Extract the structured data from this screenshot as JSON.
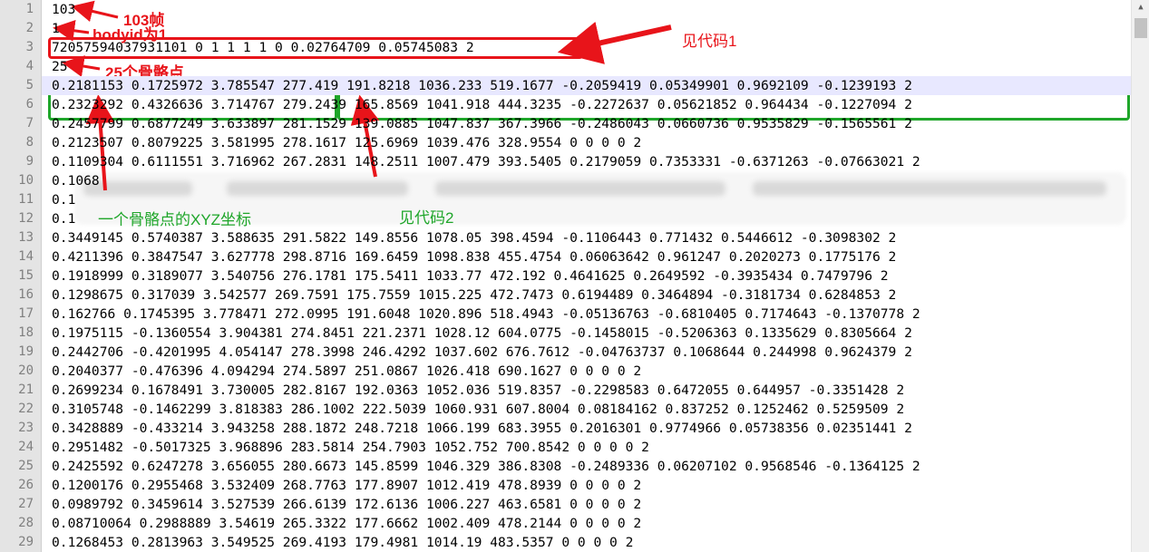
{
  "editor": {
    "line_numbers": [
      "1",
      "2",
      "3",
      "4",
      "5",
      "6",
      "7",
      "8",
      "9",
      "10",
      "11",
      "12",
      "13",
      "14",
      "15",
      "16",
      "17",
      "18",
      "19",
      "20",
      "21",
      "22",
      "23",
      "24",
      "25",
      "26",
      "27",
      "28",
      "29"
    ],
    "lines": [
      "103",
      "1",
      "72057594037931101 0 1 1 1 1 0 0.02764709 0.05745083 2",
      "25",
      "0.2181153 0.1725972 3.785547 277.419 191.8218 1036.233 519.1677 -0.2059419 0.05349901 0.9692109 -0.1239193 2",
      "0.2323292 0.4326636 3.714767 279.2439 165.8569 1041.918 444.3235 -0.2272637 0.05621852 0.964434 -0.1227094 2",
      "0.2457799 0.6877249 3.633897 281.1529 139.0885 1047.837 367.3966 -0.2486043 0.0660736 0.9535829 -0.1565561 2",
      "0.2123507 0.8079225 3.581995 278.1617 125.6969 1039.476 328.9554 0 0 0 0 2",
      "0.1109304 0.6111551 3.716962 267.2831 148.2511 1007.479 393.5405 0.2179059 0.7353331 -0.6371263 -0.07663021 2",
      "0.1068",
      "0.1",
      "0.1",
      "0.3449145 0.5740387 3.588635 291.5822 149.8556 1078.05 398.4594 -0.1106443 0.771432 0.5446612 -0.3098302 2",
      "0.4211396 0.3847547 3.627778 298.8716 169.6459 1098.838 455.4754 0.06063642 0.961247 0.2020273 0.1775176 2",
      "0.1918999 0.3189077 3.540756 276.1781 175.5411 1033.77 472.192 0.4641625 0.2649592 -0.3935434 0.7479796 2",
      "0.1298675 0.317039 3.542577 269.7591 175.7559 1015.225 472.7473 0.6194489 0.3464894 -0.3181734 0.6284853 2",
      "0.162766 0.1745395 3.778471 272.0995 191.6048 1020.896 518.4943 -0.05136763 -0.6810405 0.7174643 -0.1370778 2",
      "0.1975115 -0.1360554 3.904381 274.8451 221.2371 1028.12 604.0775 -0.1458015 -0.5206363 0.1335629 0.8305664 2",
      "0.2442706 -0.4201995 4.054147 278.3998 246.4292 1037.602 676.7612 -0.04763737 0.1068644 0.244998 0.9624379 2",
      "0.2040377 -0.476396 4.094294 274.5897 251.0867 1026.418 690.1627 0 0 0 0 2",
      "0.2699234 0.1678491 3.730005 282.8167 192.0363 1052.036 519.8357 -0.2298583 0.6472055 0.644957 -0.3351428 2",
      "0.3105748 -0.1462299 3.818383 286.1002 222.5039 1060.931 607.8004 0.08184162 0.837252 0.1252462 0.5259509 2",
      "0.3428889 -0.433214 3.943258 288.1872 248.7218 1066.199 683.3955 0.2016301 0.9774966 0.05738356 0.02351441 2",
      "0.2951482 -0.5017325 3.968896 283.5814 254.7903 1052.752 700.8542 0 0 0 0 2",
      "0.2425592 0.6247278 3.656055 280.6673 145.8599 1046.329 386.8308 -0.2489336 0.06207102 0.9568546 -0.1364125 2",
      "0.1200176 0.2955468 3.532409 268.7763 177.8907 1012.419 478.8939 0 0 0 0 2",
      "0.0989792 0.3459614 3.527539 266.6139 172.6136 1006.227 463.6581 0 0 0 0 2",
      "0.08710064 0.2988889 3.54619 265.3322 177.6662 1002.409 478.2144 0 0 0 0 2",
      "0.1268453 0.2813963 3.549525 269.4193 179.4981 1014.19 483.5357 0 0 0 0 2"
    ]
  },
  "annotations": {
    "frames": "103帧",
    "bodyid": "bodyid为1",
    "code1": "见代码1",
    "joints": "25个骨骼点",
    "xyz": "一个骨骼点的XYZ坐标",
    "code2": "见代码2"
  },
  "colors": {
    "annotation_red": "#e8141a",
    "annotation_green": "#1fa62a",
    "gutter": "#e4e4e4",
    "current_line": "#e8e8ff"
  }
}
